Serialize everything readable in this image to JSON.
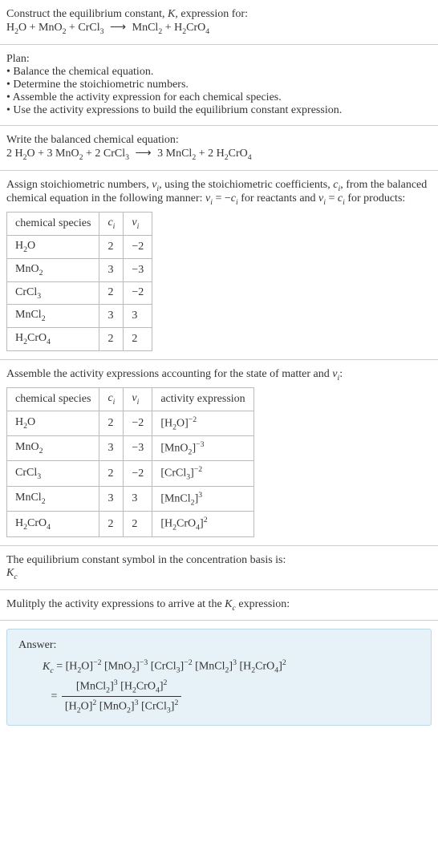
{
  "intro": {
    "line": "Construct the equilibrium constant, K, expression for:",
    "equationText": "H₂O + MnO₂ + CrCl₃  ⟶  MnCl₂ + H₂CrO₄"
  },
  "plan": {
    "title": "Plan:",
    "items": [
      "• Balance the chemical equation.",
      "• Determine the stoichiometric numbers.",
      "• Assemble the activity expression for each chemical species.",
      "• Use the activity expressions to build the equilibrium constant expression."
    ]
  },
  "balanced": {
    "title": "Write the balanced chemical equation:",
    "equationText": "2 H₂O + 3 MnO₂ + 2 CrCl₃  ⟶  3 MnCl₂ + 2 H₂CrO₄"
  },
  "stoich": {
    "intro1": "Assign stoichiometric numbers, νᵢ, using the stoichiometric coefficients, cᵢ, from",
    "intro2": "the balanced chemical equation in the following manner: νᵢ = −cᵢ for reactants",
    "intro3": "and νᵢ = cᵢ for products:",
    "headers": {
      "h1": "chemical species",
      "h2": "cᵢ",
      "h3": "νᵢ"
    },
    "rows": [
      {
        "species": "H₂O",
        "ci": "2",
        "vi": "−2"
      },
      {
        "species": "MnO₂",
        "ci": "3",
        "vi": "−3"
      },
      {
        "species": "CrCl₃",
        "ci": "2",
        "vi": "−2"
      },
      {
        "species": "MnCl₂",
        "ci": "3",
        "vi": "3"
      },
      {
        "species": "H₂CrO₄",
        "ci": "2",
        "vi": "2"
      }
    ]
  },
  "activity": {
    "title": "Assemble the activity expressions accounting for the state of matter and νᵢ:",
    "headers": {
      "h1": "chemical species",
      "h2": "cᵢ",
      "h3": "νᵢ",
      "h4": "activity expression"
    },
    "rows": [
      {
        "species": "H₂O",
        "ci": "2",
        "vi": "−2",
        "act": "[H₂O]⁻²"
      },
      {
        "species": "MnO₂",
        "ci": "3",
        "vi": "−3",
        "act": "[MnO₂]⁻³"
      },
      {
        "species": "CrCl₃",
        "ci": "2",
        "vi": "−2",
        "act": "[CrCl₃]⁻²"
      },
      {
        "species": "MnCl₂",
        "ci": "3",
        "vi": "3",
        "act": "[MnCl₂]³"
      },
      {
        "species": "H₂CrO₄",
        "ci": "2",
        "vi": "2",
        "act": "[H₂CrO₄]²"
      }
    ]
  },
  "symbol": {
    "line1": "The equilibrium constant symbol in the concentration basis is:",
    "kc": "K_c"
  },
  "multiply": {
    "title": "Mulitply the activity expressions to arrive at the K_c expression:"
  },
  "answer": {
    "label": "Answer:",
    "kc": "K_c",
    "line1": " = [H₂O]⁻² [MnO₂]⁻³ [CrCl₃]⁻² [MnCl₂]³ [H₂CrO₄]²",
    "eq": " = ",
    "num": "[MnCl₂]³ [H₂CrO₄]²",
    "den": "[H₂O]² [MnO₂]³ [CrCl₃]²"
  },
  "chart_data": {
    "type": "table",
    "tables": [
      {
        "title": "Stoichiometric numbers",
        "columns": [
          "chemical species",
          "cᵢ",
          "νᵢ"
        ],
        "rows": [
          [
            "H₂O",
            2,
            -2
          ],
          [
            "MnO₂",
            3,
            -3
          ],
          [
            "CrCl₃",
            2,
            -2
          ],
          [
            "MnCl₂",
            3,
            3
          ],
          [
            "H₂CrO₄",
            2,
            2
          ]
        ]
      },
      {
        "title": "Activity expressions",
        "columns": [
          "chemical species",
          "cᵢ",
          "νᵢ",
          "activity expression"
        ],
        "rows": [
          [
            "H₂O",
            2,
            -2,
            "[H₂O]^-2"
          ],
          [
            "MnO₂",
            3,
            -3,
            "[MnO₂]^-3"
          ],
          [
            "CrCl₃",
            2,
            -2,
            "[CrCl₃]^-2"
          ],
          [
            "MnCl₂",
            3,
            3,
            "[MnCl₂]^3"
          ],
          [
            "H₂CrO₄",
            2,
            2,
            "[H₂CrO₄]^2"
          ]
        ]
      }
    ]
  }
}
